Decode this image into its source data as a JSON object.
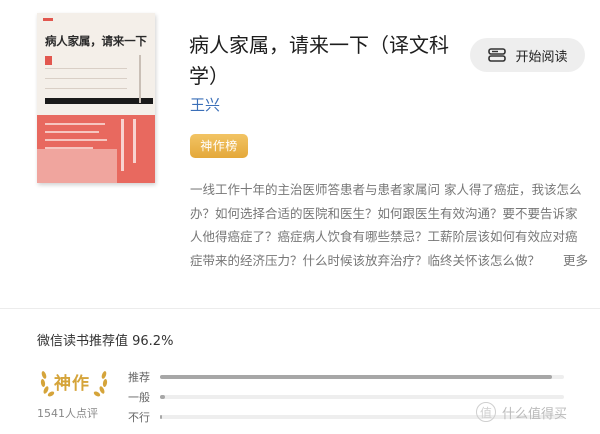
{
  "book": {
    "cover_title": "病人家属，请来一下",
    "title": "病人家属，请来一下（译文科学）",
    "author": "王兴",
    "badge": "神作榜",
    "description": "一线工作十年的主治医师答患者与患者家属问 家人得了癌症，我该怎么办？如何选择合适的医院和医生？如何跟医生有效沟通？要不要告诉家人他得癌症了？癌症病人饮食有哪些禁忌？工薪阶层该如何有效应对癌症带来的经济压力？什么时候该放弃治疗？临终关怀该怎么做？",
    "more_label": "更多"
  },
  "actions": {
    "read_label": "开始阅读",
    "read_icon": "book-open-icon"
  },
  "rating": {
    "score_text": "微信读书推荐值 96.2%",
    "level_label": "神作",
    "count_text": "1541人点评",
    "rows": [
      {
        "label": "推荐",
        "fraction": 0.97
      },
      {
        "label": "一般",
        "fraction": 0.012
      },
      {
        "label": "不行",
        "fraction": 0.006
      }
    ]
  },
  "colors": {
    "accent_gold": "#d5a43a",
    "author_blue": "#3b6fb8",
    "cover_red": "#e8695f"
  },
  "watermark": {
    "icon_text": "值",
    "text": "什么值得买"
  }
}
